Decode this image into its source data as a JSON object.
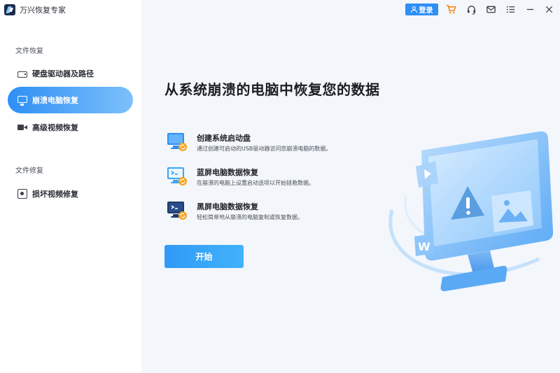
{
  "app": {
    "name": "万兴恢复专家"
  },
  "titlebar": {
    "login_label": "登录",
    "icons": [
      "user-icon",
      "cart-icon",
      "headset-icon",
      "mail-icon",
      "menu-icon",
      "minimize-icon",
      "close-icon"
    ]
  },
  "sidebar": {
    "groups": [
      {
        "label": "文件恢复"
      },
      {
        "label": "文件修复"
      }
    ],
    "items": [
      {
        "label": "硬盘驱动器及路径",
        "icon": "hard-drive-icon",
        "active": false
      },
      {
        "label": "崩溃电脑恢复",
        "icon": "monitor-icon",
        "active": true
      },
      {
        "label": "高级视频恢复",
        "icon": "video-camera-icon",
        "active": false
      },
      {
        "label": "损坏视频修复",
        "icon": "video-repair-icon",
        "active": false
      }
    ]
  },
  "main": {
    "title": "从系统崩溃的电脑中恢复您的数据",
    "options": [
      {
        "title": "创建系统启动盘",
        "desc": "通过创建可启动的USB驱动器访问您崩溃电脑的数据。",
        "icon": "bootable-drive-icon"
      },
      {
        "title": "蓝屏电脑数据恢复",
        "desc": "在崩溃的电脑上设置启动选项以开始拯救数据。",
        "icon": "blue-screen-icon"
      },
      {
        "title": "黑屏电脑数据恢复",
        "desc": "轻松简单地从崩溃的电脑复制或恢复数据。",
        "icon": "black-screen-icon"
      }
    ],
    "start_label": "开始"
  },
  "colors": {
    "accent": "#2f8ff5",
    "active_nav_start": "#2e8ff5",
    "active_nav_end": "#7cc0fb",
    "sidebar_bg": "#ffffff",
    "main_bg": "#f3f6fb",
    "cart": "#f5820f"
  }
}
